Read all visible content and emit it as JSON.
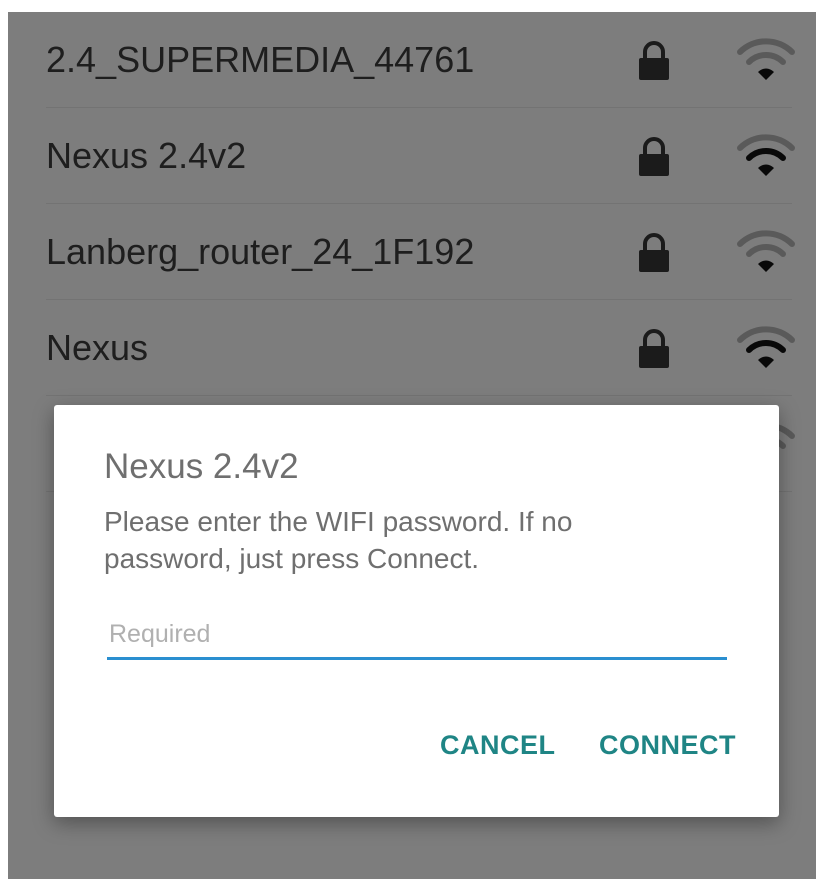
{
  "networks": [
    {
      "name": "2.4_SUPERMEDIA_44761",
      "signal": "weak"
    },
    {
      "name": "Nexus 2.4v2",
      "signal": "strong"
    },
    {
      "name": "Lanberg_router_24_1F192",
      "signal": "weak"
    },
    {
      "name": "Nexus",
      "signal": "strong"
    },
    {
      "name": "",
      "signal": "hidden"
    }
  ],
  "icons": {
    "lock": "lock-icon",
    "signal": "wifi-signal-icon"
  },
  "dialog": {
    "title": "Nexus 2.4v2",
    "message": "Please enter the WIFI password. If no password, just press Connect.",
    "input_placeholder": "Required",
    "input_value": "",
    "cancel_label": "CANCEL",
    "connect_label": "CONNECT"
  },
  "colors": {
    "accent": "#1f8585",
    "input_underline": "#2a8fd0",
    "scrim": "rgba(0,0,0,0.47)"
  }
}
